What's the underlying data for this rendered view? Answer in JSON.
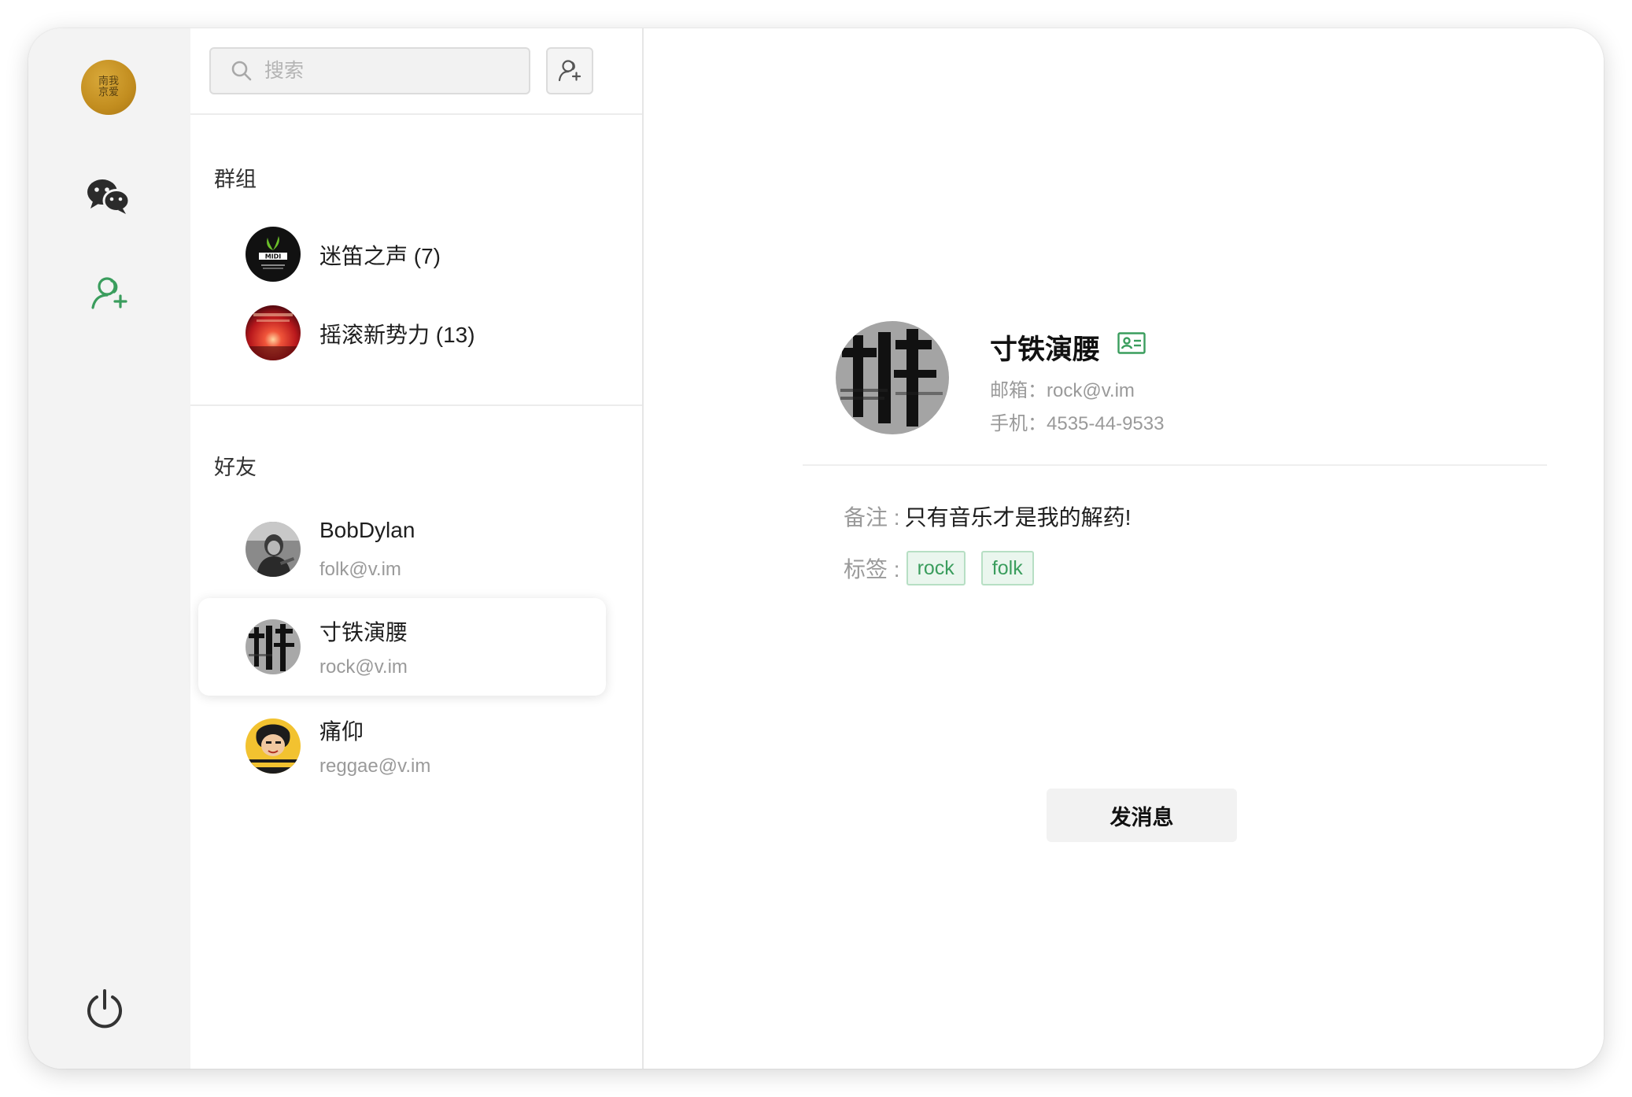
{
  "rail": {
    "me_avatar_text": "南我京爱",
    "nav": [
      "chat-icon",
      "contacts-icon",
      "power-icon"
    ],
    "active_color": "#3a9d5d"
  },
  "search": {
    "placeholder": "搜索",
    "value": ""
  },
  "groups": {
    "title": "群组",
    "items": [
      {
        "label": "迷笛之声 (7)"
      },
      {
        "label": "摇滚新势力 (13)"
      }
    ]
  },
  "friends": {
    "title": "好友",
    "items": [
      {
        "name": "BobDylan",
        "email": "folk@v.im"
      },
      {
        "name": "寸铁演腰",
        "email": "rock@v.im",
        "selected": true
      },
      {
        "name": "痛仰",
        "email": "reggae@v.im"
      }
    ]
  },
  "detail": {
    "name": "寸铁演腰",
    "email_label": "邮箱：",
    "email": "rock@v.im",
    "phone_label": "手机：",
    "phone": "4535-44-9533",
    "remark_label": "备注 :",
    "remark": "只有音乐才是我的解药!",
    "tags_label": "标签 :",
    "tags": [
      "rock",
      "folk"
    ],
    "send_label": "发消息"
  },
  "colors": {
    "accent": "#3a9d5d",
    "rail_bg": "#f3f3f3",
    "muted_text": "#9a9a9a"
  }
}
